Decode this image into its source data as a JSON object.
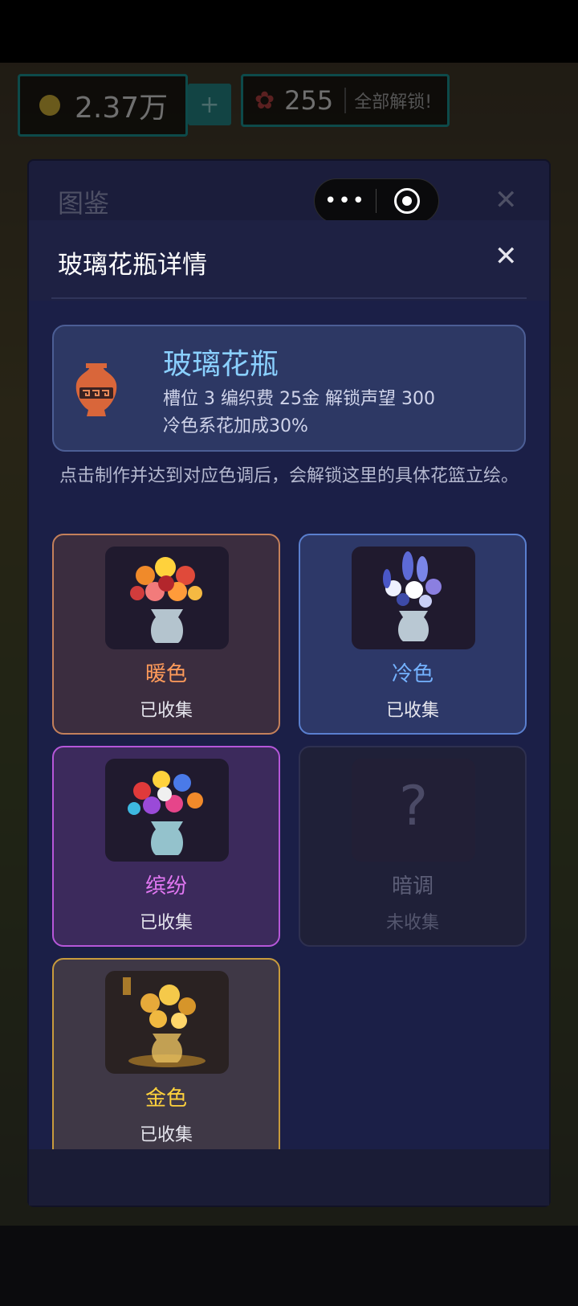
{
  "hud": {
    "coins": "2.37万",
    "plus": "+",
    "petals": "255",
    "unlock_all": "全部解锁!"
  },
  "outer": {
    "title": "图鉴",
    "close": "✕"
  },
  "capsule": {
    "more": "•••"
  },
  "detail": {
    "title": "玻璃花瓶详情",
    "close": "✕",
    "vase": {
      "name": "玻璃花瓶",
      "stats": "槽位 3  编织费 25金  解锁声望 300",
      "bonus": "冷色系花加成30%"
    },
    "hint": "点击制作并达到对应色调后，会解锁这里的具体花篮立绘。",
    "cards": [
      {
        "name": "暖色",
        "status": "已收集",
        "color": "#ff9b5a"
      },
      {
        "name": "冷色",
        "status": "已收集",
        "color": "#74b2ff"
      },
      {
        "name": "缤纷",
        "status": "已收集",
        "color": "#e177f2"
      },
      {
        "name": "暗调",
        "status": "未收集",
        "placeholder": "?"
      },
      {
        "name": "金色",
        "status": "已收集",
        "color": "#ffd23c"
      }
    ]
  }
}
